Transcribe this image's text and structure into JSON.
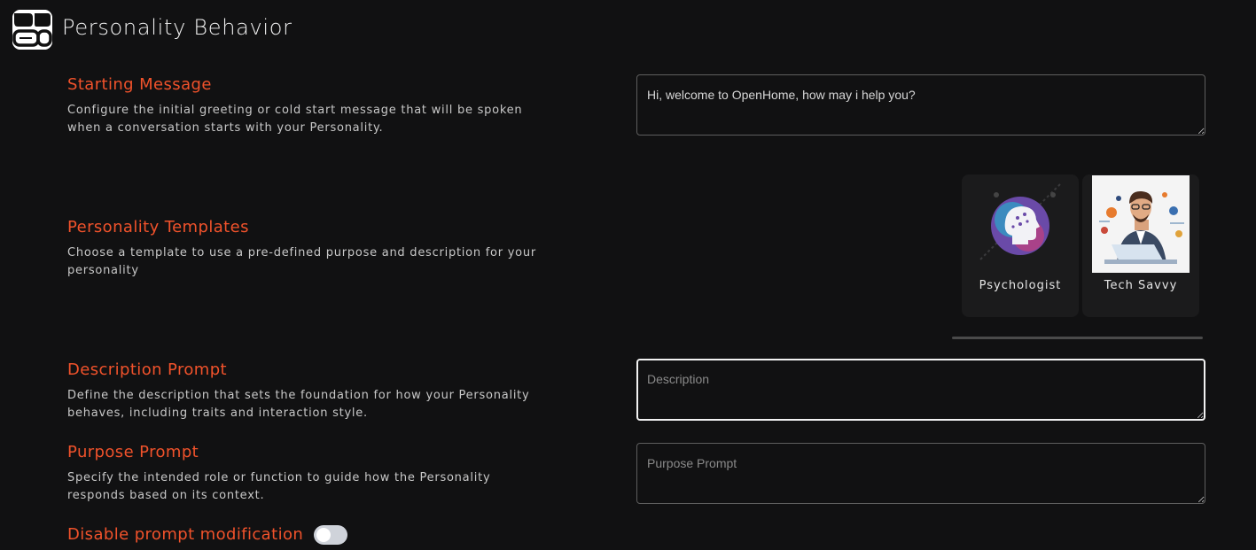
{
  "header": {
    "title": "Personality Behavior",
    "logo_icon": "openhome-logo-icon"
  },
  "starting_message": {
    "title": "Starting Message",
    "description": "Configure the initial greeting or cold start message that will be spoken when a conversation starts with your Personality.",
    "value": "Hi, welcome to OpenHome, how may i help you?"
  },
  "templates": {
    "title": "Personality Templates",
    "description": "Choose a template to use a pre-defined purpose and description for your personality",
    "items": [
      {
        "label": "Psychologist",
        "icon": "brain-head-icon"
      },
      {
        "label": "Tech Savvy",
        "icon": "developer-laptop-icon"
      }
    ]
  },
  "description_prompt": {
    "title": "Description Prompt",
    "description": "Define the description that sets the foundation for how your Personality behaves, including traits and interaction style.",
    "placeholder": "Description",
    "value": ""
  },
  "purpose_prompt": {
    "title": "Purpose Prompt",
    "description": "Specify the intended role or function to guide how the Personality responds based on its context.",
    "placeholder": "Purpose Prompt",
    "value": ""
  },
  "disable_prompt_modification": {
    "label": "Disable prompt modification",
    "enabled": false
  },
  "colors": {
    "accent": "#f0522b",
    "background": "#111112",
    "card": "#1b1b1c"
  }
}
